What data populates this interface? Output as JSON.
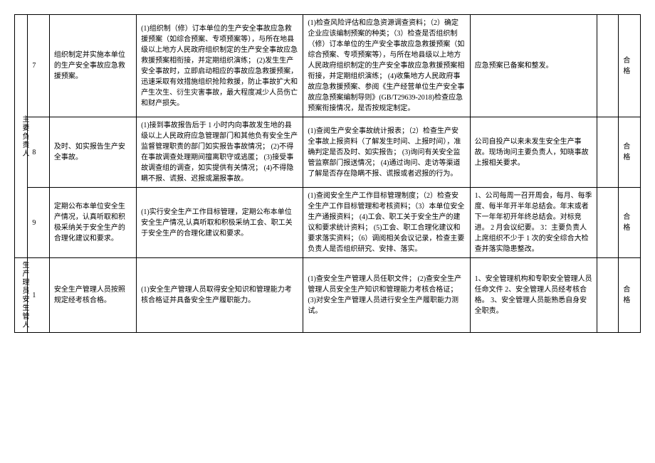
{
  "categories": {
    "cat1": "主要负责人",
    "cat2": "生产理员安生管人"
  },
  "rows": [
    {
      "num": "7",
      "item": "组织制定并实施本单位的生产安全事故应急救援预案。",
      "req": "(1)组织制（修）订本单位的生产安全事故应急救援预案（如综合预案、专项预案等），与所在地县级以上地方人民政府组织制定的生产安全事故应急救援预案相衔接，并定期组织演练；\n(2)发生生产安全事故时，立即启动相应的事故应急救援预案，迅速采取有效措施组织抢险救援，防止事故扩大和产生次生、衍生灾害事故，最大程度减少人员伤亡和财产损失。",
      "check": "(1)检查风险评估和应急资源调查资料；（2）确定企业应该编制预案的种类；（3）检查是否组织制（修）订本单位的生产安全事故应急救援预案（如综合预案、专项预案等），与所在地县级以上地方人民政府组织制定的生产安全事故应急救援预案相衔接，并定期组织演练；\n(4)收集地方人民政府事故应急救援预案、参阅《生产经营单位生产安全事故应急预案编制导则》(GB/T29639-2018)检查应急预案衔接情况，是否按规定制定。",
      "note": "应急预案已备案和整发。",
      "result": "合格"
    },
    {
      "num": "8",
      "item": "及时、如实报告生产安全事故。",
      "req": "(1)接到事故报告后于 1 小时内向事故发生地的县级以上人民政府应急管理部门和其他负有安全生产监督管理职责的部门如实报告事故情况；\n(2)不得在事故调查处理期间擅离职守或逃匿；\n(3)接受事故调查组的调查，如实提供有关情况；\n(4)不得隐瞒不报、谎报、迟报或漏报事故。",
      "check": "(1)查阅生产安全事故统计报表；（2）检查生产安全事故上报资料（了解发生时间、上报时间），准确判定是否及时、如实报告；\n(3)询问有关安全监管监察部门报送情况；\n(4)通过询问、走访等渠道了解是否存在隐瞒不报、谎报或者迟报的行为。",
      "note": "公司自投产以来未发生安全生产事故。现场询问主要负责人，知晓事故上报相关要求。",
      "result": "合格"
    },
    {
      "num": "9",
      "item": "定期公布本单位安全生产情况，认真听取和积极采纳关于安全生产的合理化建议和要求。",
      "req": "(1)实行安全生产工作目标管理，定期公布本单位安全生产情况,认真听取和积极采纳工会、职工关于安全生产的合理化建议和要求。",
      "check": "(1)查阅安全生产工作目标管理制度；（2）检查安全生产工作目标管理和考核资料；（3）本单位安全生产通报资料；\n(4)工会、职工关于安全生产的建议和要求统计资料；\n(5)工会、职工合理化建议和要求落实资料；（6）调阅相关会议记录，检查主要负责人是否组织研究、安排、落实。",
      "note": "1、公司每周一召开周会，每月、每季度、每半年开半年总结会。年末或者下一年年初开年终总结会。对标竞进。\n2 月会议纪要。\n3：主要负责人上席组织不少于 1 次的安全综合大检查并落实隐患整改。",
      "result": "合格"
    },
    {
      "num": "1",
      "item": "安全生产管理人员按照规定经考核合格。",
      "req": "(1)安全生产管理人员取得安全知识和管理能力考核合格证并具备安全生产履职能力。",
      "check": "(1)查安全生产管理人员任职文件；\n(2)查安全生产管理人员安全生产知识和管理能力考核合格证；\n(3)对安全生产管理人员进行安全生产履职能力测试。",
      "note": "1、安全管理机构和专职安全管理人员任命文件\n2、安全管理人员经考核合格。\n3、安全管理人员能熟悉自身安全职责。",
      "result": "合格"
    }
  ]
}
